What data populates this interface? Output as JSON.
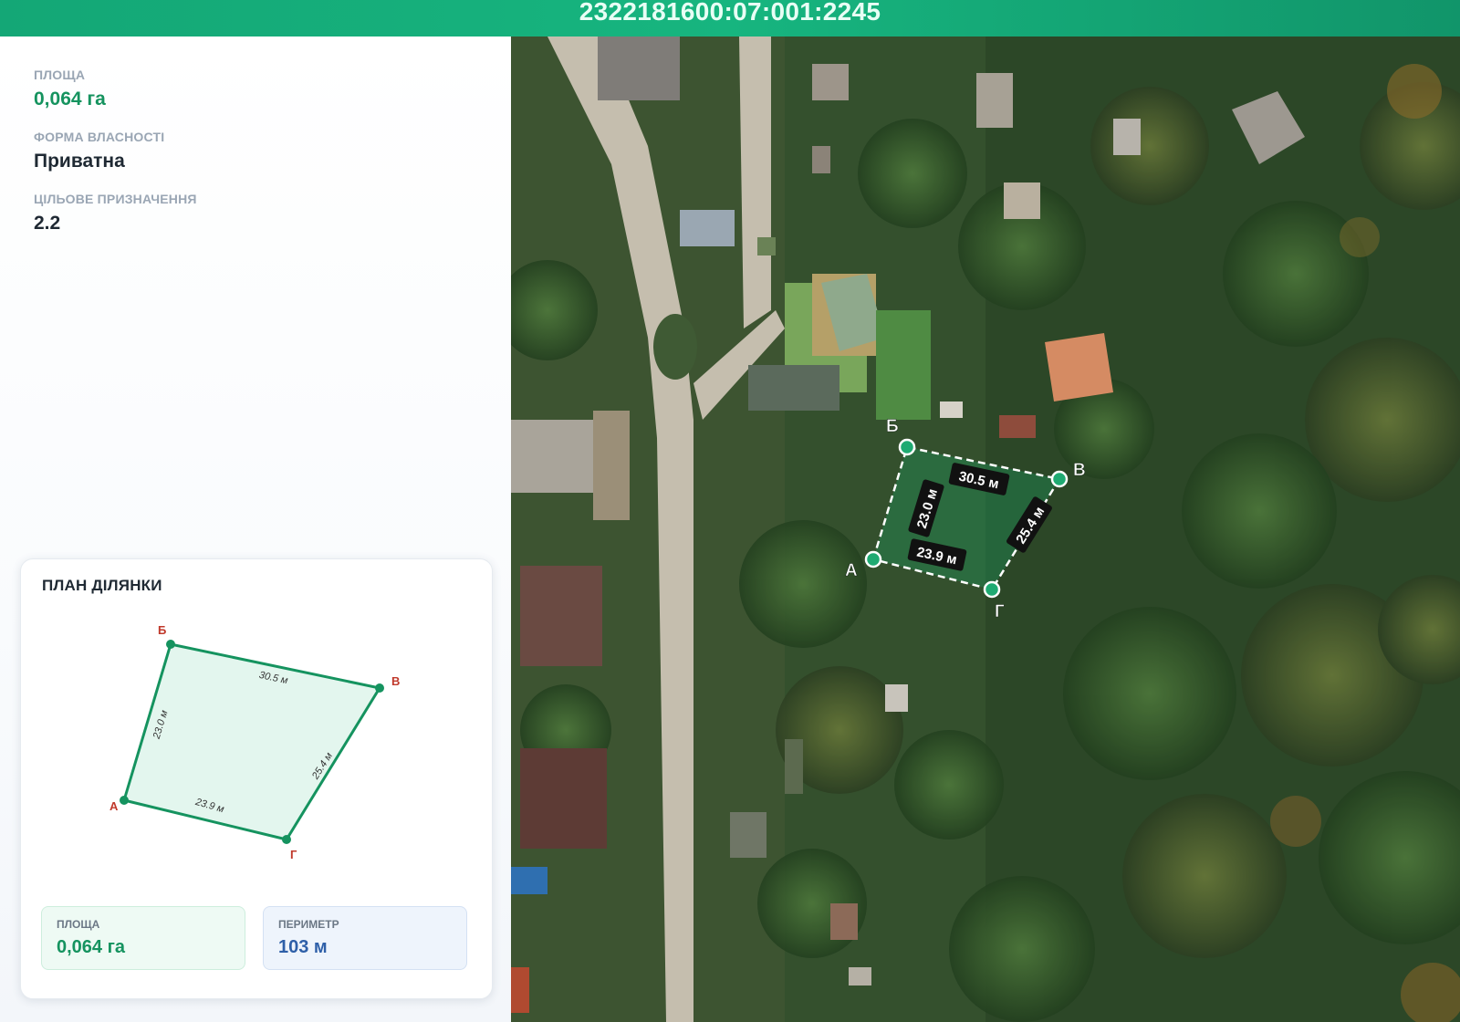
{
  "header": {
    "cadastral_number": "2322181600:07:001:2245"
  },
  "info": {
    "area_label": "ПЛОЩА",
    "area_value": "0,064 га",
    "ownership_label": "ФОРМА ВЛАСНОСТІ",
    "ownership_value": "Приватна",
    "purpose_label": "ЦІЛЬОВЕ ПРИЗНАЧЕННЯ",
    "purpose_value": "2.2"
  },
  "plan": {
    "title": "ПЛАН ДІЛЯНКИ",
    "vertices": [
      "А",
      "Б",
      "В",
      "Г"
    ],
    "sides": {
      "ab": "23.0 м",
      "bv": "30.5 м",
      "vg": "25.4 м",
      "ga": "23.9 м"
    },
    "stats": {
      "area_label": "ПЛОЩА",
      "area_value": "0,064 га",
      "perimeter_label": "ПЕРИМЕТР",
      "perimeter_value": "103 м"
    }
  },
  "colors": {
    "accent_green": "#15935f",
    "header_green": "#17b57f",
    "vertex_red": "#c0392b",
    "perimeter_blue": "#2e5fa8"
  }
}
